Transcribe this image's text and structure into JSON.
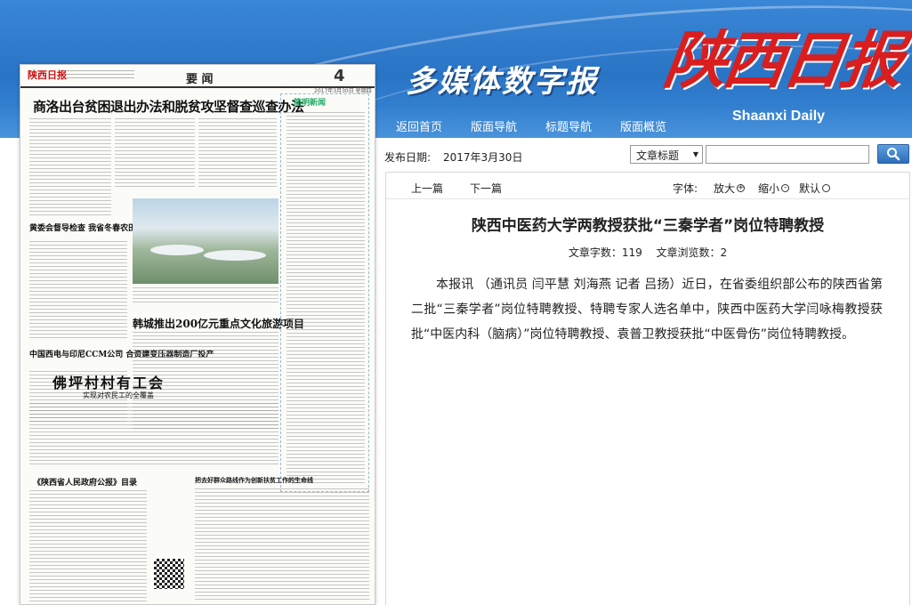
{
  "header": {
    "site_title": "多媒体数字报",
    "logo_chinese": "陕西日报",
    "logo_english": "Shaanxi Daily",
    "nav": [
      "返回首页",
      "版面导航",
      "标题导航",
      "版面概览"
    ]
  },
  "colors": {
    "header_blue": "#2a74c6",
    "logo_red": "#d81e1e",
    "search_button": "#2d6fb8"
  },
  "newspaper": {
    "logo": "陕西日报",
    "section": "要 闻",
    "page_number": "4",
    "date": "2017年3月30日 星期四",
    "headline": "商洛出台贫困退出办法和脱贫攻坚督查巡查办法",
    "side_title": "简明新闻",
    "story2": "黄委会督导检查 我省冬春农田水利基本建设",
    "story3": "中国西电与印尼CCM公司 合资建变压器制造厂投产",
    "story4": "韩城推出200亿元重点文化旅游项目",
    "story5": "佛坪村村有工会",
    "story5_sub": "实现对农民工的全覆盖",
    "story6": "《陕西省人民政府公报》目录",
    "story7": "把去好群众路线作为创新扶贫工作的生命线"
  },
  "date_bar": {
    "label": "发布日期:",
    "value": "2017年3月30日"
  },
  "search": {
    "select_value": "文章标题",
    "input_value": "",
    "button_icon": "search-icon"
  },
  "article_nav": {
    "prev": "上一篇",
    "next": "下一篇",
    "font_label": "字体:",
    "font_large": "放大",
    "font_small": "缩小",
    "font_default": "默认"
  },
  "article": {
    "title": "陕西中医药大学两教授获批“三秦学者”岗位特聘教授",
    "word_count": "文章字数：119",
    "view_count": "文章浏览数：2",
    "body": "本报讯 （通讯员 闫平慧 刘海燕 记者 吕扬）近日，在省委组织部公布的陕西省第二批“三秦学者”岗位特聘教授、特聘专家人选名单中，陕西中医药大学闫咏梅教授获批“中医内科（脑病）”岗位特聘教授、袁普卫教授获批“中医骨伤”岗位特聘教授。"
  }
}
